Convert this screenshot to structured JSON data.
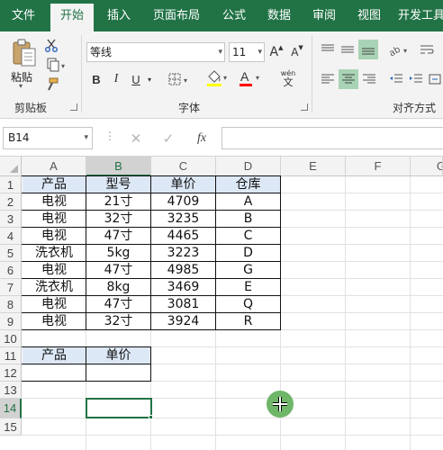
{
  "tabs": [
    {
      "label": "文件",
      "active": false
    },
    {
      "label": "开始",
      "active": true
    },
    {
      "label": "插入",
      "active": false
    },
    {
      "label": "页面布局",
      "active": false
    },
    {
      "label": "公式",
      "active": false
    },
    {
      "label": "数据",
      "active": false
    },
    {
      "label": "审阅",
      "active": false
    },
    {
      "label": "视图",
      "active": false
    },
    {
      "label": "开发工具",
      "active": false
    }
  ],
  "ribbon": {
    "clipboard": {
      "paste_label": "粘贴",
      "group_label": "剪贴板"
    },
    "font": {
      "font_name": "等线",
      "font_size": "11",
      "bold": "B",
      "italic": "I",
      "underline": "U",
      "grow": "A",
      "shrink": "A",
      "phonetic_top": "wén",
      "phonetic_bottom": "文",
      "group_label": "字体",
      "font_color": "#ff0000",
      "highlight_color": "#ffff00"
    },
    "alignment": {
      "group_label": "对齐方式"
    }
  },
  "formula_bar": {
    "name_box": "B14",
    "fx": "fx",
    "formula": ""
  },
  "sheet": {
    "columns": [
      "A",
      "B",
      "C",
      "D",
      "E",
      "F",
      "G"
    ],
    "rows": [
      "1",
      "2",
      "3",
      "4",
      "5",
      "6",
      "7",
      "8",
      "9",
      "10",
      "11",
      "12",
      "13",
      "14",
      "15"
    ],
    "table1_header": [
      "产品",
      "型号",
      "单价",
      "仓库"
    ],
    "table1_rows": [
      [
        "电视",
        "21寸",
        "4709",
        "A"
      ],
      [
        "电视",
        "32寸",
        "3235",
        "B"
      ],
      [
        "电视",
        "47寸",
        "4465",
        "C"
      ],
      [
        "洗衣机",
        "5kg",
        "3223",
        "D"
      ],
      [
        "电视",
        "47寸",
        "4985",
        "G"
      ],
      [
        "洗衣机",
        "8kg",
        "3469",
        "E"
      ],
      [
        "电视",
        "47寸",
        "3081",
        "Q"
      ],
      [
        "电视",
        "32寸",
        "3924",
        "R"
      ]
    ],
    "table2_header": [
      "产品",
      "单价"
    ],
    "table2_row": [
      "",
      ""
    ],
    "active_cell": "B14",
    "header_fill": "#dde8f6",
    "accent": "#217346"
  }
}
